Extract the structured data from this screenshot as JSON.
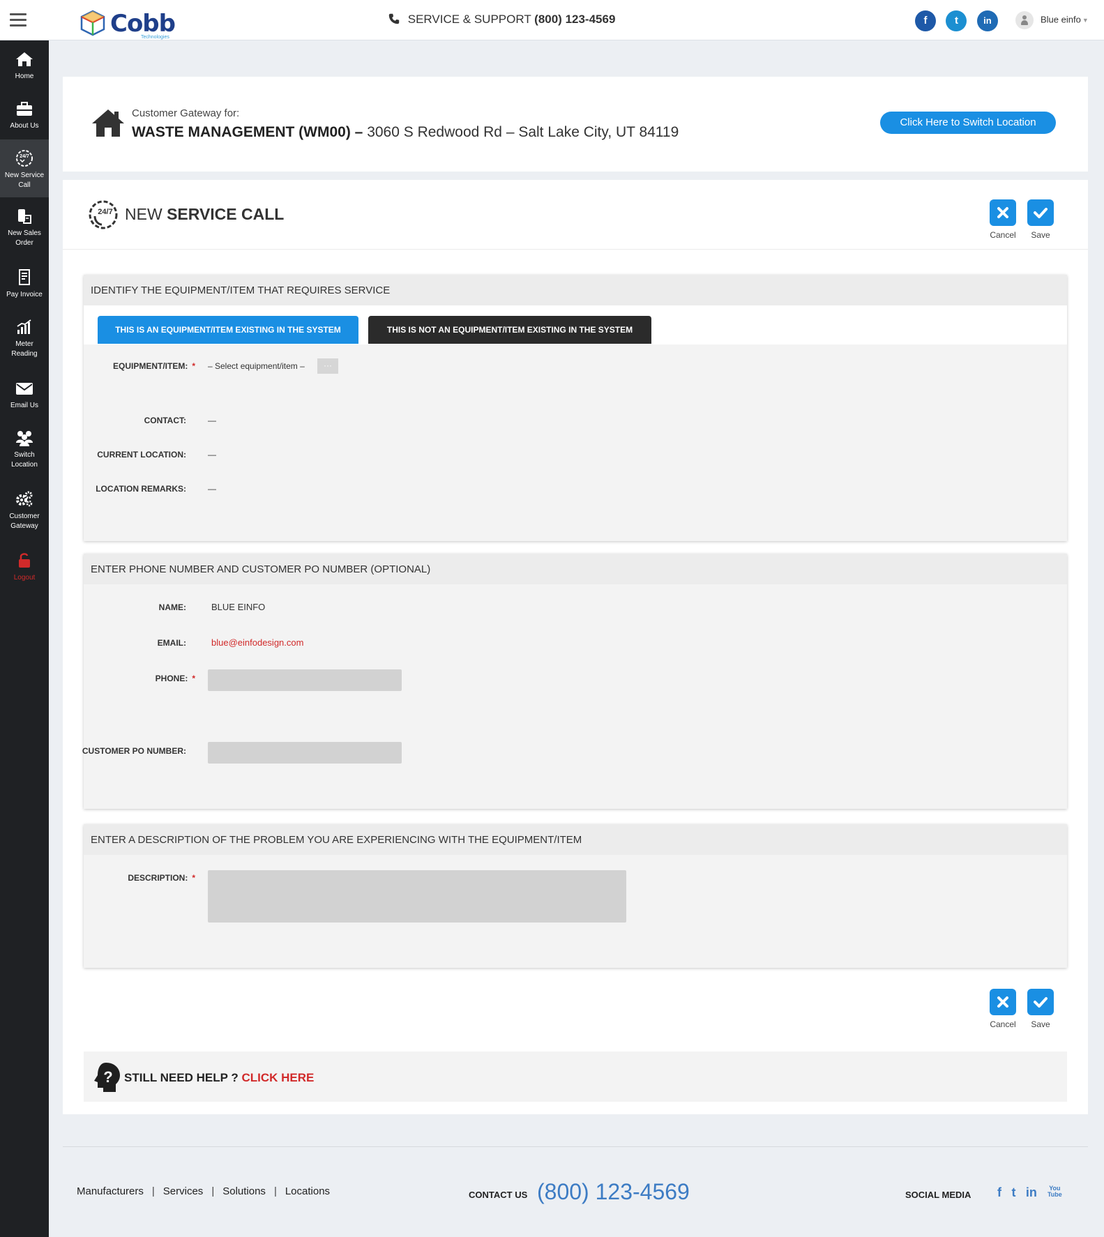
{
  "header": {
    "logo_text": "Cobb",
    "logo_sub": "Technologies",
    "support_label": "SERVICE & SUPPORT",
    "support_phone": "(800) 123-4569",
    "social": [
      {
        "icon": "facebook-icon",
        "glyph": "f",
        "color": "#1e59a8"
      },
      {
        "icon": "twitter-icon",
        "glyph": "t",
        "color": "#1c8fd1"
      },
      {
        "icon": "linkedin-icon",
        "glyph": "in",
        "color": "#1f6bb5"
      }
    ],
    "user_name": "Blue einfo"
  },
  "sidebar": {
    "items": [
      {
        "label": "Home",
        "icon": "home-icon"
      },
      {
        "label": "About Us",
        "icon": "briefcase-icon"
      },
      {
        "label": "New Service Call",
        "icon": "service-24-7-icon",
        "active": true
      },
      {
        "label": "New Sales Order",
        "icon": "sales-order-icon"
      },
      {
        "label": "Pay Invoice",
        "icon": "invoice-icon"
      },
      {
        "label": "Meter Reading",
        "icon": "meter-chart-icon"
      },
      {
        "label": "Email Us",
        "icon": "envelope-icon"
      },
      {
        "label": "Switch Location",
        "icon": "group-icon"
      },
      {
        "label": "Customer Gateway",
        "icon": "gears-icon"
      },
      {
        "label": "Logout",
        "icon": "lock-icon"
      }
    ]
  },
  "gateway": {
    "label": "Customer Gateway for:",
    "customer": "WASTE MANAGEMENT (WM00) –",
    "address": "3060 S Redwood Rd – Salt Lake City, UT 84119",
    "switch_button": "Click Here to Switch Location"
  },
  "page": {
    "title_light": "NEW",
    "title_bold": "SERVICE CALL",
    "cancel_label": "Cancel",
    "save_label": "Save"
  },
  "equipment_section": {
    "heading": "IDENTIFY THE EQUIPMENT/ITEM THAT REQUIRES SERVICE",
    "tab_existing": "THIS IS AN EQUIPMENT/ITEM EXISTING IN THE SYSTEM",
    "tab_not_existing": "THIS IS NOT AN EQUIPMENT/ITEM EXISTING IN THE SYSTEM",
    "equipment_label": "EQUIPMENT/ITEM:",
    "equipment_value": "– Select equipment/item –",
    "picker_button": "···",
    "contact_label": "CONTACT:",
    "contact_value": "—",
    "location_label": "CURRENT LOCATION:",
    "location_value": "—",
    "remarks_label": "LOCATION REMARKS:",
    "remarks_value": "—"
  },
  "phone_section": {
    "heading": "ENTER PHONE NUMBER AND CUSTOMER PO NUMBER (OPTIONAL)",
    "name_label": "NAME:",
    "name_value": "BLUE EINFO",
    "email_label": "EMAIL:",
    "email_value": "blue@einfodesign.com",
    "phone_label": "PHONE:",
    "phone_value": "",
    "po_label": "CUSTOMER PO NUMBER:",
    "po_value": ""
  },
  "description_section": {
    "heading": "ENTER A DESCRIPTION OF THE PROBLEM YOU ARE EXPERIENCING WITH THE EQUIPMENT/ITEM",
    "description_label": "DESCRIPTION:",
    "description_value": ""
  },
  "help": {
    "text": "STILL NEED HELP ?",
    "link": "CLICK HERE"
  },
  "footer": {
    "links": [
      "Manufacturers",
      "Services",
      "Solutions",
      "Locations"
    ],
    "contact_label": "CONTACT US",
    "contact_phone": "(800) 123-4569",
    "social_label": "SOCIAL MEDIA",
    "social": [
      "f",
      "t",
      "in",
      "You Tube"
    ]
  },
  "colors": {
    "accent_blue": "#1a8fe3",
    "dark_tab": "#2b2b2b",
    "sidebar_bg": "#1f2124",
    "alert_red": "#d12a2a"
  }
}
